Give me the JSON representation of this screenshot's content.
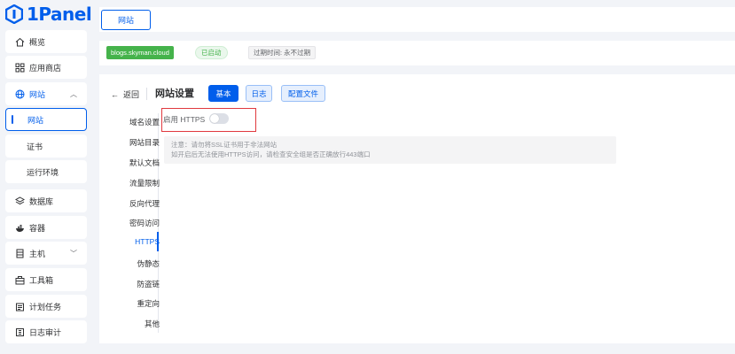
{
  "app": {
    "brand": "1Panel"
  },
  "colors": {
    "accent": "#005eeb",
    "success": "#45b34b",
    "highlight_border": "#e0393e"
  },
  "sidebar": {
    "items": [
      {
        "label": "概览",
        "icon": "home-icon"
      },
      {
        "label": "应用商店",
        "icon": "grid-icon"
      },
      {
        "label": "网站",
        "icon": "globe-icon",
        "expanded": true
      },
      {
        "label": "网站",
        "active": true
      },
      {
        "label": "证书"
      },
      {
        "label": "运行环境"
      },
      {
        "label": "数据库",
        "icon": "layers-icon"
      },
      {
        "label": "容器",
        "icon": "docker-icon"
      },
      {
        "label": "主机",
        "icon": "server-icon",
        "expandable": true
      },
      {
        "label": "工具箱",
        "icon": "toolbox-icon"
      },
      {
        "label": "计划任务",
        "icon": "calendar-icon"
      },
      {
        "label": "日志审计",
        "icon": "log-icon"
      }
    ]
  },
  "top_tabs": [
    {
      "label": "网站"
    }
  ],
  "site_info": {
    "domain": "blogs.skyman.cloud",
    "status": "已启动",
    "expire": "过期时间: 永不过期"
  },
  "panel": {
    "back_label": "返回",
    "title": "网站设置",
    "buttons": {
      "basic": "基本",
      "log": "日志",
      "config": "配置文件"
    },
    "menu": [
      "域名设置",
      "网站目录",
      "默认文档",
      "流量限制",
      "反向代理",
      "密码访问",
      "HTTPS",
      "伪静态",
      "防盗链",
      "重定向",
      "其他"
    ],
    "active_menu": "HTTPS",
    "https": {
      "label": "启用 HTTPS",
      "enabled": false,
      "notice_line1": "注意：请勿将SSL证书用于非法网站",
      "notice_line2": "如开启后无法使用HTTPS访问，请检查安全组是否正确放行443端口"
    }
  }
}
